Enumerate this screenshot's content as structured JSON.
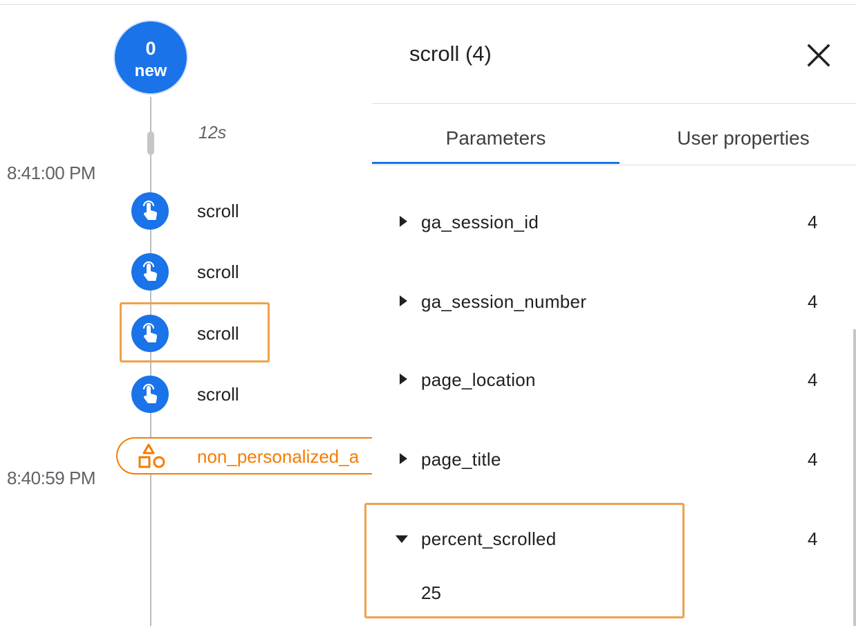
{
  "timeline": {
    "new_badge": {
      "count": "0",
      "label": "new"
    },
    "gap_label": "12s",
    "time_labels": [
      "8:41:00 PM",
      "8:40:59 PM"
    ],
    "events": [
      {
        "label": "scroll",
        "icon": "touch-icon"
      },
      {
        "label": "scroll",
        "icon": "touch-icon"
      },
      {
        "label": "scroll",
        "icon": "touch-icon",
        "highlighted": true
      },
      {
        "label": "scroll",
        "icon": "touch-icon"
      }
    ],
    "conversion_event": {
      "label": "non_personalized_a",
      "icon": "shapes-icon"
    }
  },
  "panel": {
    "title": "scroll (4)",
    "close_icon": "close-icon",
    "tabs": [
      {
        "label": "Parameters",
        "active": true
      },
      {
        "label": "User properties",
        "active": false
      }
    ],
    "parameters": [
      {
        "name": "ga_session_id",
        "count": "4",
        "expanded": false
      },
      {
        "name": "ga_session_number",
        "count": "4",
        "expanded": false
      },
      {
        "name": "page_location",
        "count": "4",
        "expanded": false
      },
      {
        "name": "page_title",
        "count": "4",
        "expanded": false
      },
      {
        "name": "percent_scrolled",
        "count": "4",
        "expanded": true,
        "value": "25"
      }
    ]
  },
  "colors": {
    "accent": "#1a73e8",
    "conversion": "#f57c00",
    "highlight": "#f0a04b"
  }
}
